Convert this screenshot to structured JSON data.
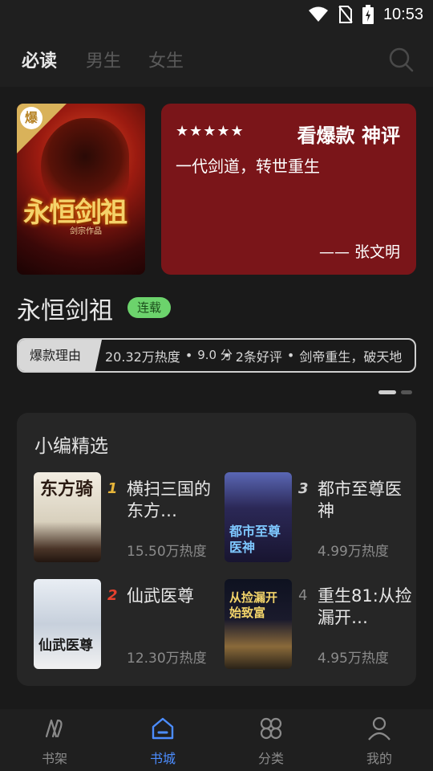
{
  "status_bar": {
    "time": "10:53"
  },
  "top_tabs": [
    "必读",
    "男生",
    "女生"
  ],
  "featured": {
    "cover_title": "永恒剑祖",
    "cover_subtitle": "剑宗作品",
    "badge": "爆",
    "quote_title": "看爆款 神评",
    "stars": "★★★★★",
    "quote_text": "一代剑道，转世重生",
    "quote_author": "—— 张文明",
    "book_title": "永恒剑祖",
    "status": "连载",
    "reason_label": "爆款理由",
    "heat": "20.32万热度",
    "score": "9.0 分",
    "reviews": "2条好评",
    "tagline": "剑帝重生，破天地"
  },
  "editor_picks": {
    "title": "小编精选",
    "books": [
      {
        "rank": "1",
        "name": "横扫三国的东方…",
        "heat": "15.50万热度",
        "rank_color": "#e7b53a",
        "cover_text": "东方骑"
      },
      {
        "rank": "3",
        "name": "都市至尊医神",
        "heat": "4.99万热度",
        "rank_color": "#cfcfcf",
        "cover_text": "都市至尊医神"
      },
      {
        "rank": "2",
        "name": "仙武医尊",
        "heat": "12.30万热度",
        "rank_color": "#e6412e",
        "cover_text": "仙武医尊"
      },
      {
        "rank": "4",
        "name": "重生81:从捡漏开…",
        "heat": "4.95万热度",
        "rank_color": "#8a8a8a",
        "cover_text": "从捡漏开始致富"
      }
    ]
  },
  "bottom_nav": [
    {
      "label": "书架",
      "icon": "bookshelf-icon"
    },
    {
      "label": "书城",
      "icon": "bookstore-icon"
    },
    {
      "label": "分类",
      "icon": "category-icon"
    },
    {
      "label": "我的",
      "icon": "profile-icon"
    }
  ],
  "accent_color": "#4c8dff"
}
